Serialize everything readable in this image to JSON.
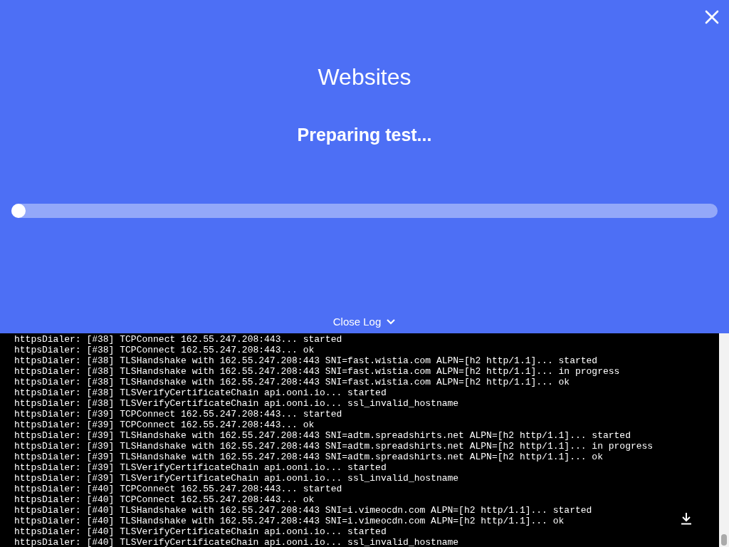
{
  "title": "Websites",
  "status": "Preparing test...",
  "progress": {
    "level": 0.01
  },
  "log_toggle": {
    "label": "Close Log",
    "expanded": true
  },
  "log_lines": [
    "httpsDialer: [#38] TCPConnect 162.55.247.208:443... started",
    "httpsDialer: [#38] TCPConnect 162.55.247.208:443... ok",
    "httpsDialer: [#38] TLSHandshake with 162.55.247.208:443 SNI=fast.wistia.com ALPN=[h2 http/1.1]... started",
    "httpsDialer: [#38] TLSHandshake with 162.55.247.208:443 SNI=fast.wistia.com ALPN=[h2 http/1.1]... in progress",
    "httpsDialer: [#38] TLSHandshake with 162.55.247.208:443 SNI=fast.wistia.com ALPN=[h2 http/1.1]... ok",
    "httpsDialer: [#38] TLSVerifyCertificateChain api.ooni.io... started",
    "httpsDialer: [#38] TLSVerifyCertificateChain api.ooni.io... ssl_invalid_hostname",
    "httpsDialer: [#39] TCPConnect 162.55.247.208:443... started",
    "httpsDialer: [#39] TCPConnect 162.55.247.208:443... ok",
    "httpsDialer: [#39] TLSHandshake with 162.55.247.208:443 SNI=adtm.spreadshirts.net ALPN=[h2 http/1.1]... started",
    "httpsDialer: [#39] TLSHandshake with 162.55.247.208:443 SNI=adtm.spreadshirts.net ALPN=[h2 http/1.1]... in progress",
    "httpsDialer: [#39] TLSHandshake with 162.55.247.208:443 SNI=adtm.spreadshirts.net ALPN=[h2 http/1.1]... ok",
    "httpsDialer: [#39] TLSVerifyCertificateChain api.ooni.io... started",
    "httpsDialer: [#39] TLSVerifyCertificateChain api.ooni.io... ssl_invalid_hostname",
    "httpsDialer: [#40] TCPConnect 162.55.247.208:443... started",
    "httpsDialer: [#40] TCPConnect 162.55.247.208:443... ok",
    "httpsDialer: [#40] TLSHandshake with 162.55.247.208:443 SNI=i.vimeocdn.com ALPN=[h2 http/1.1]... started",
    "httpsDialer: [#40] TLSHandshake with 162.55.247.208:443 SNI=i.vimeocdn.com ALPN=[h2 http/1.1]... ok",
    "httpsDialer: [#40] TLSVerifyCertificateChain api.ooni.io... started",
    "httpsDialer: [#40] TLSVerifyCertificateChain api.ooni.io... ssl_invalid_hostname"
  ]
}
